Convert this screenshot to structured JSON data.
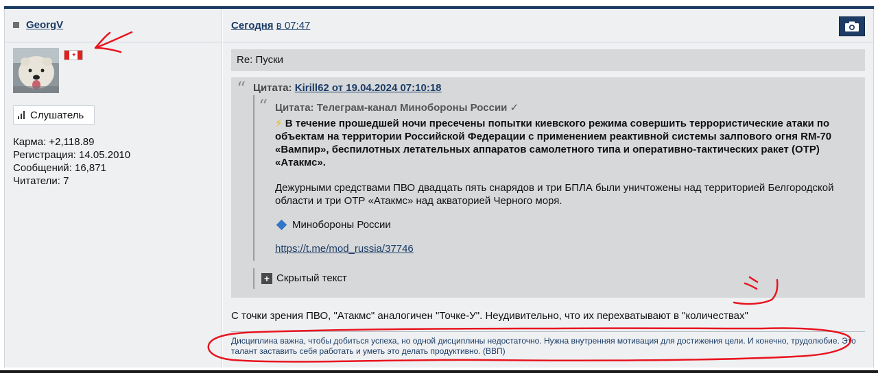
{
  "user": {
    "username": "GeorgV",
    "rank": "Слушатель",
    "stats": [
      "Карма: +2,118.89",
      "Регистрация: 14.05.2010",
      "Сообщений: 16,871",
      "Читатели: 7"
    ],
    "flag_icon": "canada-flag-icon"
  },
  "post": {
    "date_today": "Сегодня",
    "date_time": "в 07:47",
    "subject": "Re: Пуски",
    "quote": {
      "title_prefix": "Цитата:",
      "title_link": "Kirill62 от 19.04.2024 07:10:18",
      "nested": {
        "title": "Цитата: Телеграм-канал Минобороны России ✓",
        "lead_icon": "⚡",
        "lead": "В течение прошедшей ночи пресечены попытки киевского режима совершить террористические атаки по объектам на территории Российской Федерации с применением реактивной системы залпового огня RM-70 «Вампир», беспилотных летательных аппаратов самолетного типа и оперативно-тактических ракет (ОТР) «Атакмс».",
        "paragraph": "Дежурными средствами ПВО двадцать пять снарядов и три БПЛА были уничтожены над территорией Белгородской области и три ОТР «Атакмс» над акваторией Черного моря.",
        "ministry": "Минобороны России",
        "link": "https://t.me/mod_russia/37746"
      },
      "hidden_text": "Скрытый текст"
    },
    "reply": "С точки зрения ПВО, \"Атакмс\" аналогичен \"Точке-У\". Неудивительно, что их перехватывают в \"количествах\"",
    "signature": "Дисциплина важна, чтобы добиться успеха, но одной дисциплины недостаточно. Нужна внутренняя мотивация для достижения цели. И конечно, трудолюбие. Это талант заставить себя работать и уметь это делать продуктивно. (ВВП)"
  },
  "colors": {
    "accent": "#1c3c66",
    "panel": "#eef0f2",
    "quote_bg": "#d6d8da",
    "annotation": "#e8141e"
  }
}
